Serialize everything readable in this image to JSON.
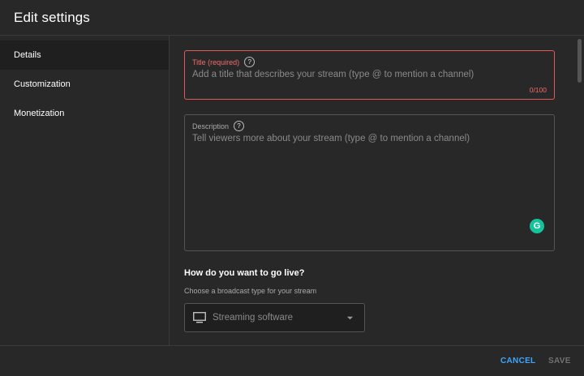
{
  "header": {
    "title": "Edit settings"
  },
  "sidebar": {
    "items": [
      {
        "label": "Details",
        "active": true
      },
      {
        "label": "Customization",
        "active": false
      },
      {
        "label": "Monetization",
        "active": false
      }
    ]
  },
  "title_field": {
    "label": "Title (required)",
    "help_icon": "?",
    "placeholder": "Add a title that describes your stream (type @ to mention a channel)",
    "value": "",
    "char_count": "0/100"
  },
  "description_field": {
    "label": "Description",
    "help_icon": "?",
    "placeholder": "Tell viewers more about your stream (type @ to mention a channel)",
    "value": "",
    "grammarly_icon": "G"
  },
  "broadcast": {
    "heading": "How do you want to go live?",
    "subheading": "Choose a broadcast type for your stream",
    "selected": "Streaming software",
    "icon": "monitor-icon"
  },
  "footer": {
    "cancel_label": "CANCEL",
    "save_label": "SAVE"
  },
  "colors": {
    "background": "#282828",
    "sidebar_active": "#1f1f1f",
    "error": "#f26b6b",
    "accent": "#3ea6ff",
    "grammarly": "#15c39a"
  }
}
